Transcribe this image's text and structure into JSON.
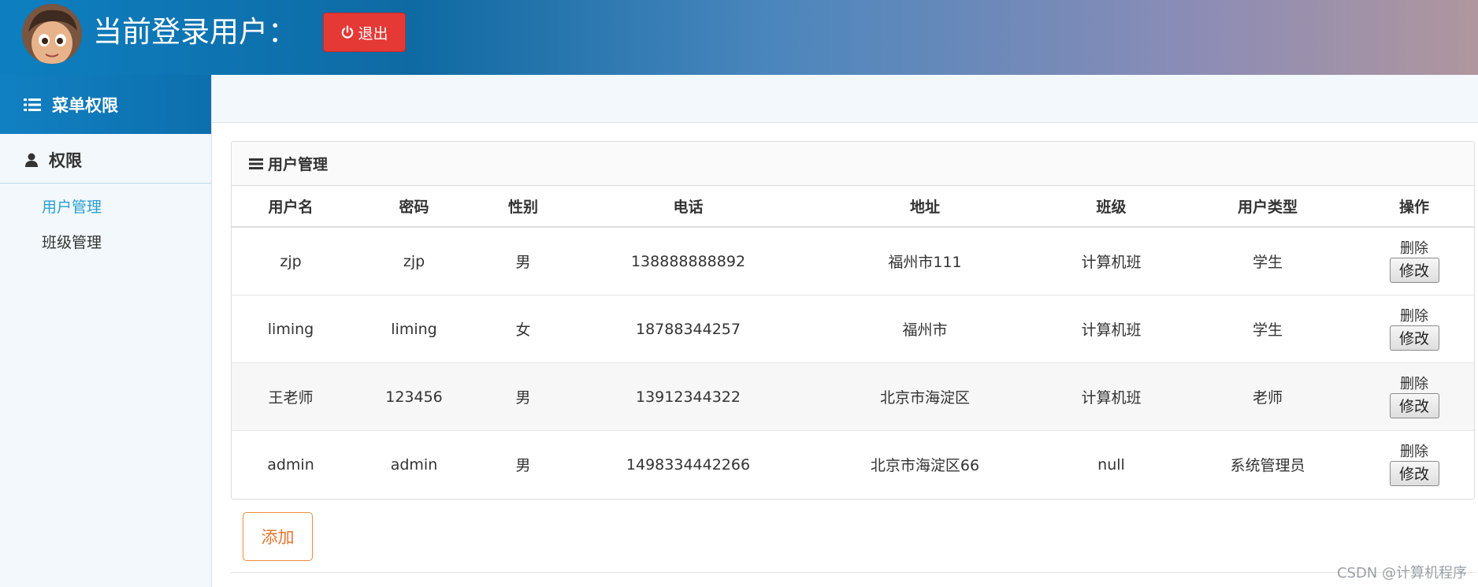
{
  "header": {
    "title": "当前登录用户：",
    "logout_label": "退出",
    "accent_color": "#e53935"
  },
  "sidebar": {
    "heading": "菜单权限",
    "section": "权限",
    "items": [
      {
        "label": "用户管理",
        "active": true
      },
      {
        "label": "班级管理",
        "active": false
      }
    ]
  },
  "panel": {
    "title": "用户管理",
    "columns": [
      "用户名",
      "密码",
      "性别",
      "电话",
      "地址",
      "班级",
      "用户类型",
      "操作"
    ],
    "rows": [
      {
        "username": "zjp",
        "password": "zjp",
        "gender": "男",
        "phone": "138888888892",
        "address": "福州市111",
        "class": "计算机班",
        "type": "学生"
      },
      {
        "username": "liming",
        "password": "liming",
        "gender": "女",
        "phone": "18788344257",
        "address": "福州市",
        "class": "计算机班",
        "type": "学生"
      },
      {
        "username": "王老师",
        "password": "123456",
        "gender": "男",
        "phone": "13912344322",
        "address": "北京市海淀区",
        "class": "计算机班",
        "type": "老师"
      },
      {
        "username": "admin",
        "password": "admin",
        "gender": "男",
        "phone": "1498334442266",
        "address": "北京市海淀区66",
        "class": "null",
        "type": "系统管理员"
      }
    ],
    "delete_label": "删除",
    "edit_label": "修改"
  },
  "add_label": "添加",
  "watermark": "CSDN @计算机程序"
}
